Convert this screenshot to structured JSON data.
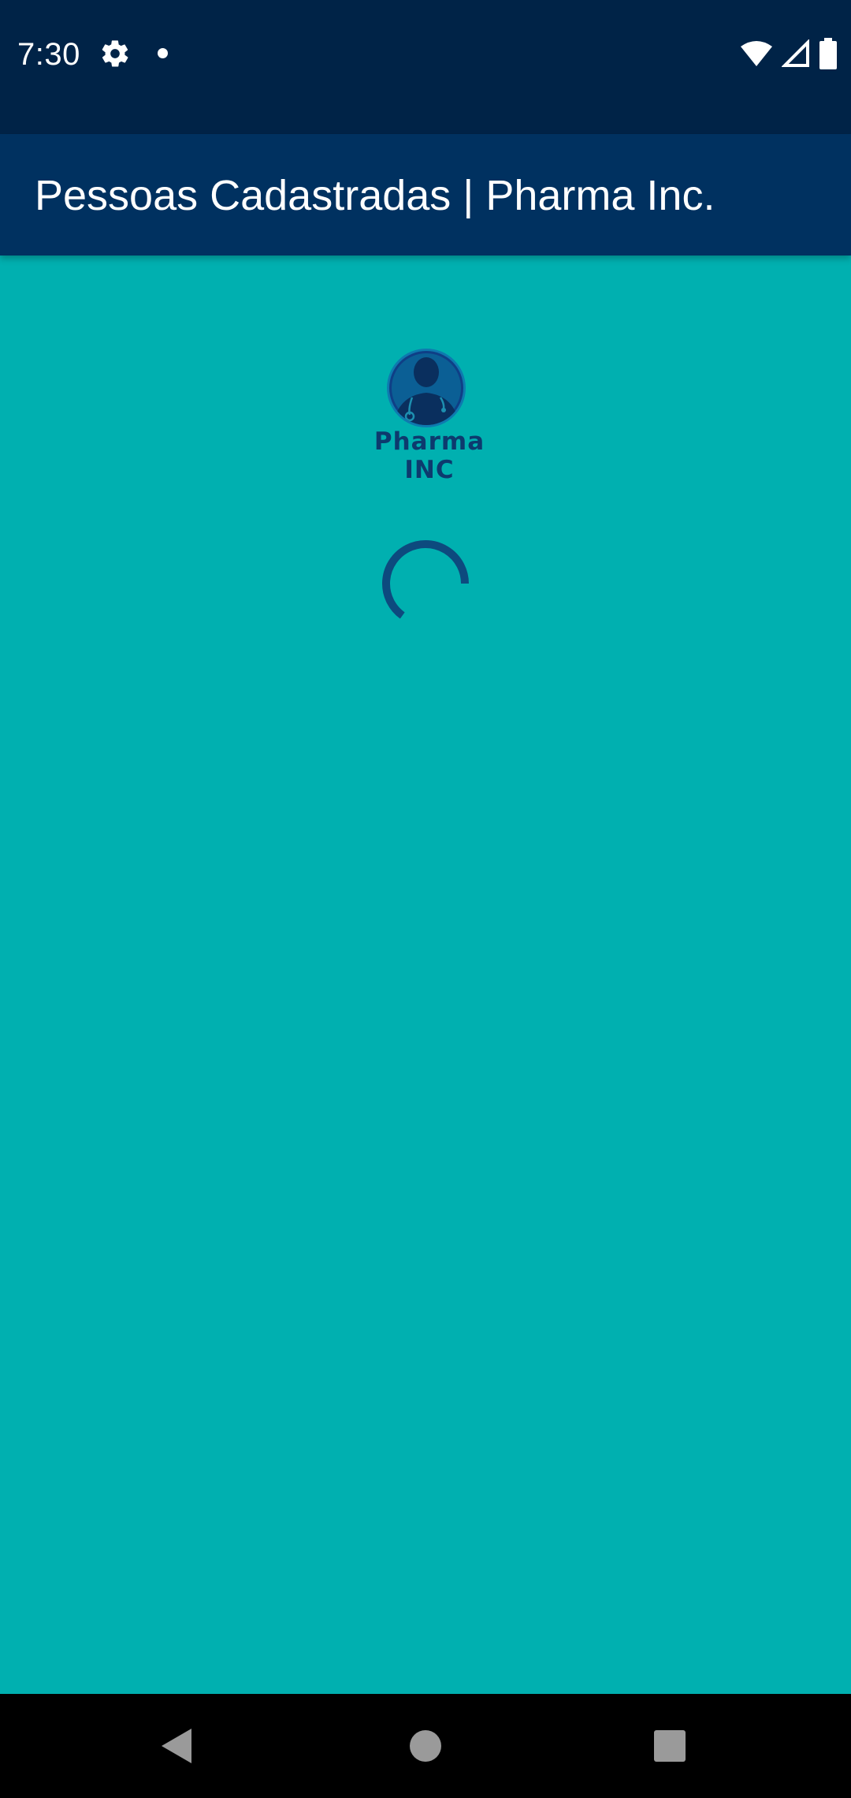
{
  "status_bar": {
    "time": "7:30",
    "icons": [
      "settings-gear-icon",
      "notification-dot-icon",
      "wifi-icon",
      "cell-signal-icon",
      "battery-icon"
    ]
  },
  "app_bar": {
    "title": "Pessoas Cadastradas | Pharma Inc."
  },
  "logo": {
    "text": "Pharma INC",
    "icon": "doctor-avatar-icon"
  },
  "loading": {
    "icon": "loading-spinner-icon"
  },
  "nav_bar": {
    "buttons": [
      "back-icon",
      "home-icon",
      "recents-icon"
    ]
  },
  "colors": {
    "status_bar": "#002347",
    "app_bar": "#003160",
    "background": "#00b0b0",
    "accent": "#0d3a6e",
    "nav_bar": "#000000"
  }
}
